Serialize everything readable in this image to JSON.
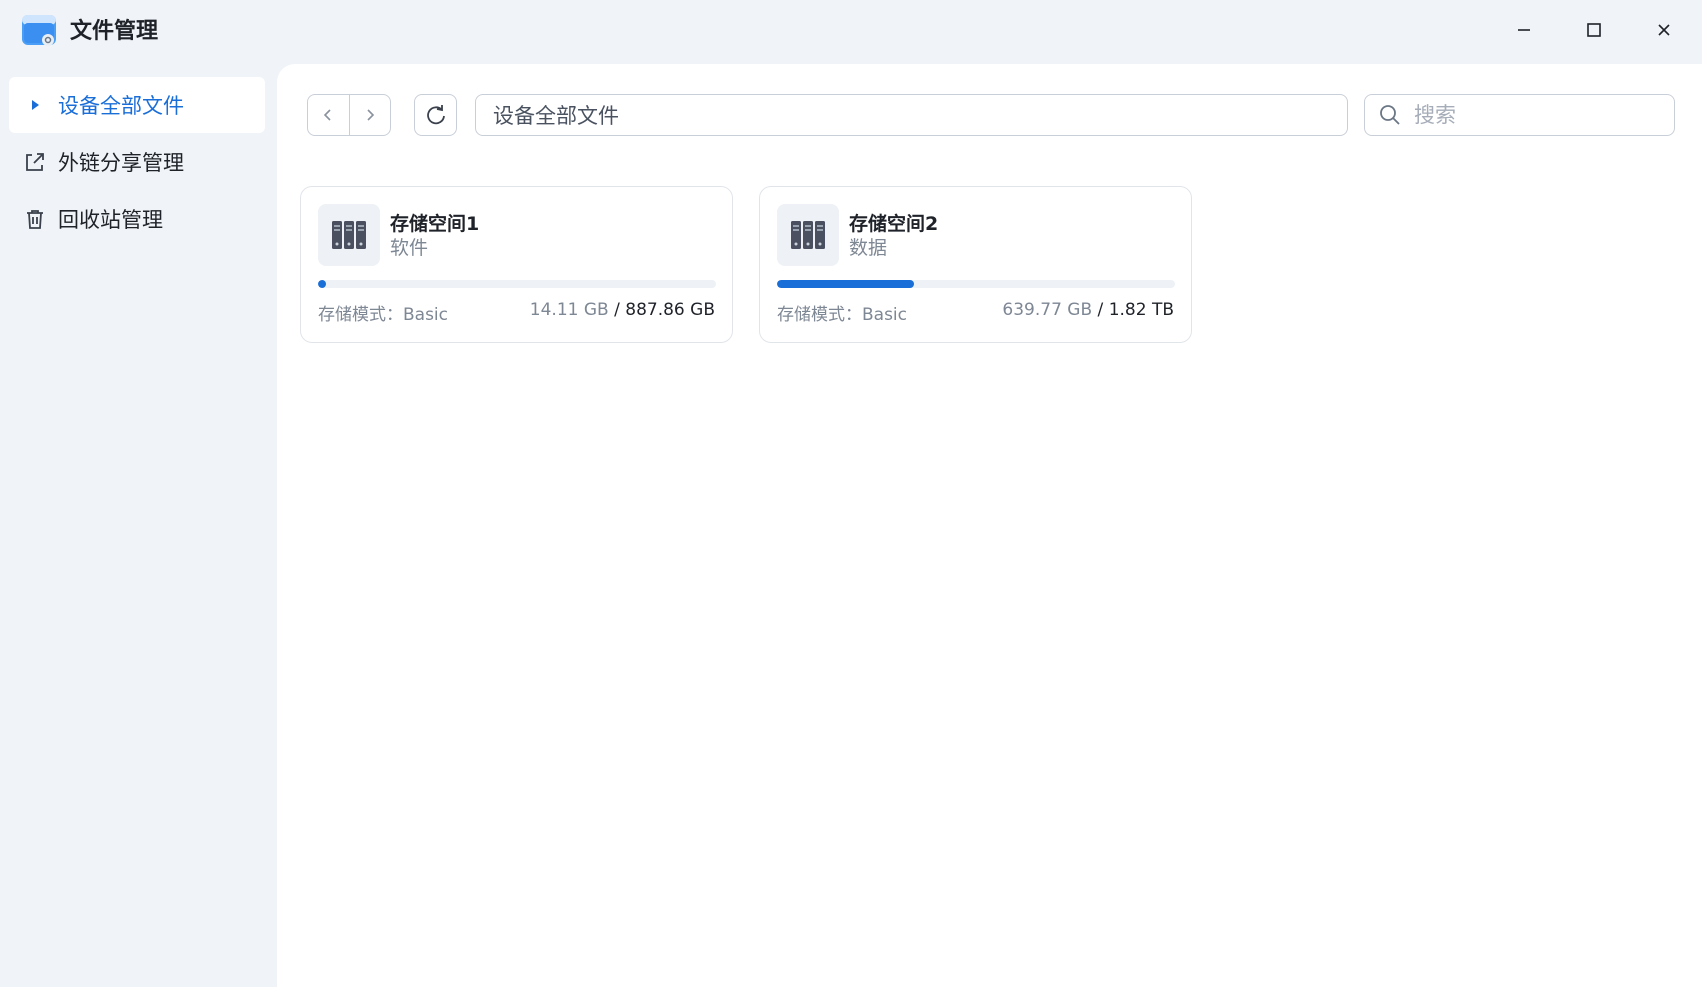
{
  "window": {
    "title": "文件管理",
    "minimize_icon": "minimize-icon",
    "maximize_icon": "maximize-icon",
    "close_icon": "close-icon"
  },
  "sidebar": {
    "items": [
      {
        "label": "设备全部文件",
        "icon": "caret-right-icon",
        "active": true
      },
      {
        "label": "外链分享管理",
        "icon": "share-link-icon",
        "active": false
      },
      {
        "label": "回收站管理",
        "icon": "trash-icon",
        "active": false
      }
    ]
  },
  "toolbar": {
    "path_value": "设备全部文件",
    "search_placeholder": "搜索"
  },
  "storages": [
    {
      "name": "存储空间1",
      "desc": "软件",
      "mode_label": "存储模式：",
      "mode": "Basic",
      "used": "14.11 GB",
      "sep": " / ",
      "total": "887.86 GB",
      "usage_fraction": 0.016
    },
    {
      "name": "存储空间2",
      "desc": "数据",
      "mode_label": "存储模式：",
      "mode": "Basic",
      "used": "639.77 GB",
      "sep": " / ",
      "total": "1.82 TB",
      "usage_fraction": 0.343
    }
  ],
  "colors": {
    "accent": "#1a6ed8",
    "background": "#f0f3f7"
  }
}
